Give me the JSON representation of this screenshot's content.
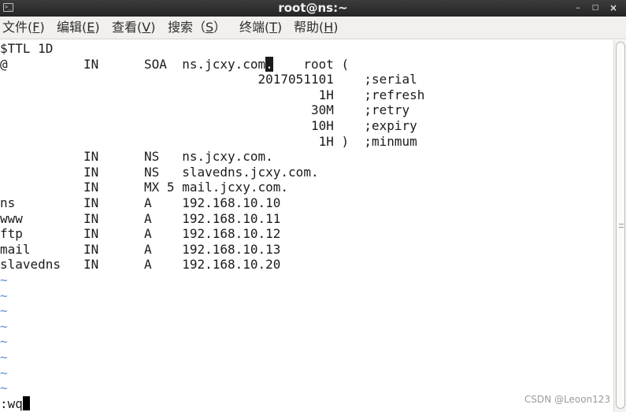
{
  "window": {
    "title": "root@ns:~",
    "icon": "terminal-icon",
    "controls": {
      "minimize": "–",
      "maximize": "□",
      "close": "×"
    }
  },
  "menubar": {
    "items": [
      {
        "label": "文件(",
        "key": "F",
        "tail": ")"
      },
      {
        "label": "编辑(",
        "key": "E",
        "tail": ")"
      },
      {
        "label": "查看(",
        "key": "V",
        "tail": ")"
      },
      {
        "label": "搜索（",
        "key": "S",
        "tail": "）"
      },
      {
        "label": "终端(",
        "key": "T",
        "tail": ")"
      },
      {
        "label": "帮助(",
        "key": "H",
        "tail": ")"
      }
    ]
  },
  "terminal": {
    "lines": [
      "$TTL 1D",
      "@          IN      SOA  ns.jcxy.com",
      "                                  2017051101    ;serial",
      "                                          1H    ;refresh",
      "                                         30M    ;retry",
      "                                         10H    ;expiry",
      "                                          1H )  ;minmum",
      "           IN      NS   ns.jcxy.com.",
      "           IN      NS   slavedns.jcxy.com.",
      "           IN      MX 5 mail.jcxy.com.",
      "ns         IN      A    192.168.10.10",
      "www        IN      A    192.168.10.11",
      "ftp        IN      A    192.168.10.12",
      "mail       IN      A    192.168.10.13",
      "slavedns   IN      A    192.168.10.20"
    ],
    "cursor_char": ".",
    "line2_tail": "    root (",
    "empty_line_marker": "~",
    "command_line": ":wq"
  },
  "watermark": "CSDN @Leoon123",
  "colors": {
    "titlebar": "#2f2f2f",
    "menubar": "#f1f0ee",
    "terminal_bg": "#ffffff",
    "terminal_fg": "#1b1b1b",
    "tilde": "#5f8fd2"
  }
}
